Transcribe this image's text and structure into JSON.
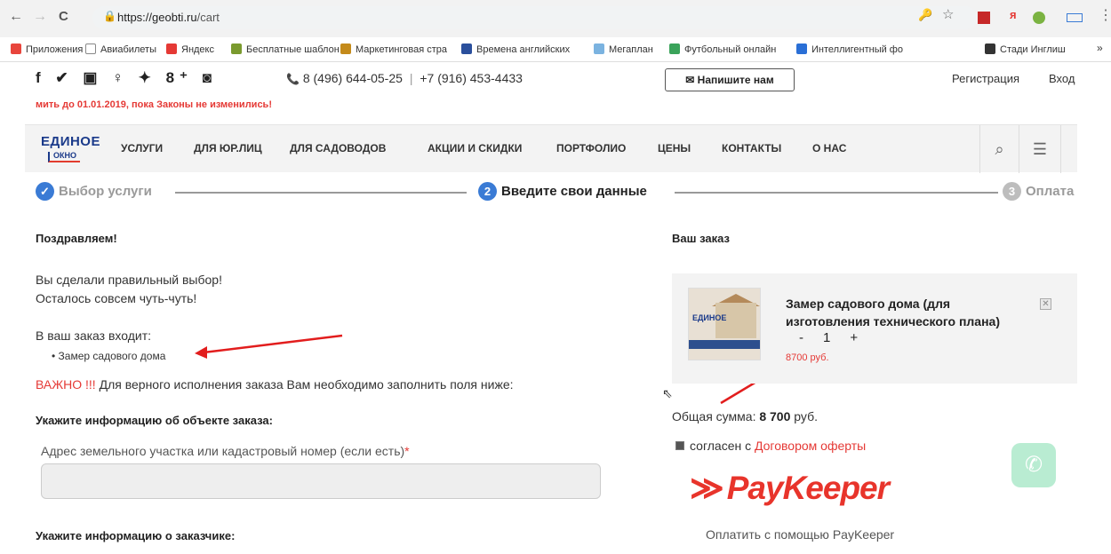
{
  "browser": {
    "back": "←",
    "forward": "→",
    "reload": "C",
    "url_host": "https://geobti.ru",
    "url_path": "/cart",
    "lock": "🔒",
    "key_icon": "🔑",
    "star_icon": "☆",
    "menu_icon": "⋮"
  },
  "bookmarks": [
    {
      "label": "Приложения",
      "color": "#e8453c"
    },
    {
      "label": "Авиабилеты",
      "color": "#888888"
    },
    {
      "label": "Яндекс",
      "color": "#e53935"
    },
    {
      "label": "Бесплатные шаблон",
      "color": "#7a9a2e"
    },
    {
      "label": "Маркетинговая стра",
      "color": "#c48a1a"
    },
    {
      "label": "Времена английских",
      "color": "#2a4f9c"
    },
    {
      "label": "Мегаплан",
      "color": "#7bb3e0"
    },
    {
      "label": "Футбольный онлайн",
      "color": "#3aa35a"
    },
    {
      "label": "Интеллигентный фо",
      "color": "#2a6fd6"
    },
    {
      "label": "Стади Инглиш",
      "color": "#333333"
    }
  ],
  "bookmarks_more": "»",
  "header": {
    "social": "f ✔ ▣ ♀ ✦ 8⁺ ◙",
    "phone_icon": "📞",
    "phone1": "8 (496) 644-05-25",
    "phone_sep": "|",
    "phone2": "+7 (916) 453-4433",
    "write_button": "✉ Напишите нам",
    "register": "Регистрация",
    "login": "Вход",
    "ticker": "мить до 01.01.2019, пока Законы не изменились!"
  },
  "logo": {
    "top": "ЕДИНОЕ",
    "bottom": "ОКНО"
  },
  "menu": [
    "УСЛУГИ",
    "ДЛЯ ЮР.ЛИЦ",
    "ДЛЯ САДОВОДОВ",
    "АКЦИИ И СКИДКИ",
    "ПОРТФОЛИО",
    "ЦЕНЫ",
    "КОНТАКТЫ",
    "О НАС"
  ],
  "nav_tools": {
    "search": "⌕",
    "hamburger": "☰"
  },
  "steps": [
    {
      "num": "✓",
      "label": "Выбор услуги",
      "color": "#3a7bd5",
      "text_color": "#9a9a9a"
    },
    {
      "num": "2",
      "label": "Введите свои данные",
      "color": "#3a7bd5",
      "text_color": "#222222"
    },
    {
      "num": "3",
      "label": "Оплата",
      "color": "#bdbdbd",
      "text_color": "#9a9a9a"
    }
  ],
  "left": {
    "congrats": "Поздравляем!",
    "line1": "Вы сделали правильный выбор!",
    "line2": "Осталось совсем чуть-чуть!",
    "order_includes": "В ваш заказ входит:",
    "order_item": "• Замер садового дома",
    "important_red": "ВАЖНО !!!",
    "important_rest": " Для верного исполнения заказа Вам необходимо заполнить поля ниже:",
    "object_heading": "Укажите информацию об объекте заказа:",
    "address_label": "Адрес земельного участка или кадастровый номер (если есть)",
    "required_star": "*",
    "customer_heading": "Укажите информацию о заказчике:"
  },
  "right": {
    "order_heading": "Ваш заказ",
    "item_title": "Замер садового дома (для изготовления технического плана)",
    "qty_minus": "-",
    "qty_value": "1",
    "qty_plus": "+",
    "price": "8700 руб.",
    "remove": "✕",
    "total_label": "Общая сумма: ",
    "total_value": "8 700",
    "total_unit": " руб.",
    "agree_text": "согласен с ",
    "agree_link": "Договором оферты",
    "paykeeper_arrow": "≫",
    "paykeeper": "PayKeeper",
    "pay_caption": "Оплатить с помощью PayKeeper",
    "phone_fab": "✆",
    "thumb_logo": "ЕДИНОЕ"
  },
  "cursor": "⇖"
}
